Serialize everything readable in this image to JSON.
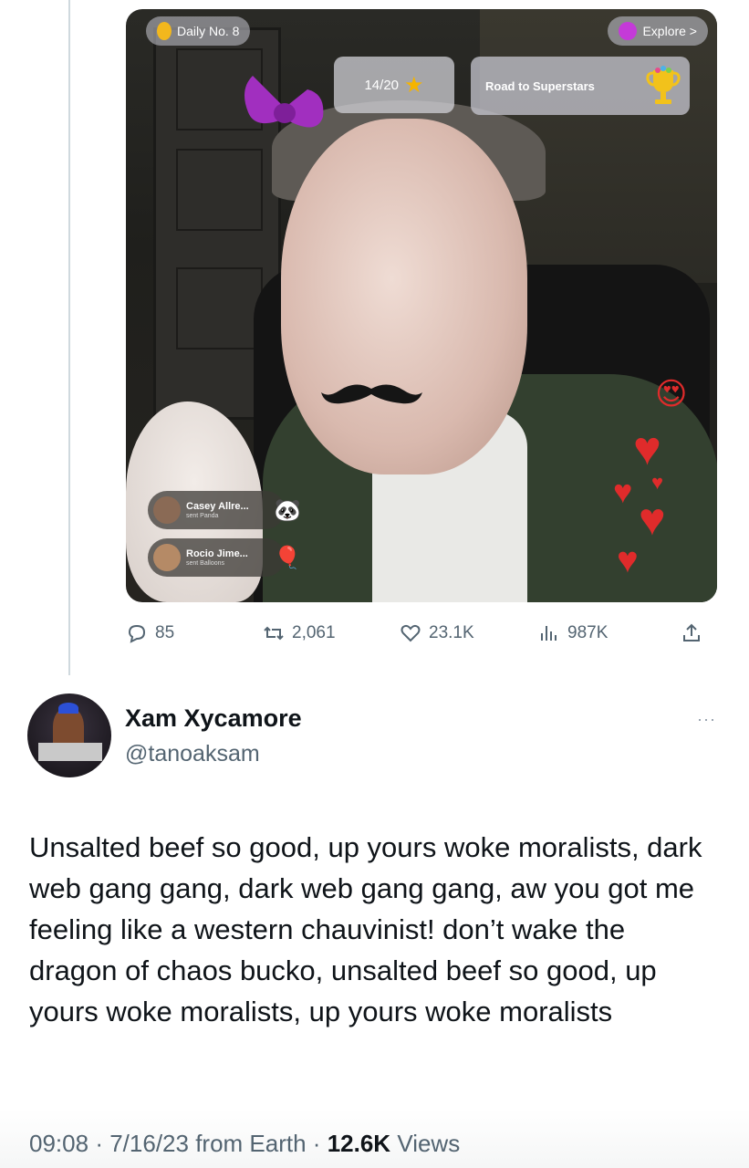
{
  "media": {
    "daily_label": "Daily No. 8",
    "explore_label": "Explore >",
    "progress_label": "14/20",
    "road_label": "Road to Superstars",
    "gifts": [
      {
        "name": "Casey Allre...",
        "sub": "sent Panda",
        "emoji": "🐼"
      },
      {
        "name": "Rocio Jime...",
        "sub": "sent Balloons",
        "emoji": "🎈"
      }
    ]
  },
  "actions": {
    "replies": "85",
    "reposts": "2,061",
    "likes": "23.1K",
    "views": "987K"
  },
  "author": {
    "display_name": "Xam Xycamore",
    "handle": "@tanoaksam",
    "more": "···"
  },
  "tweet": {
    "text": "Unsalted beef so good, up yours woke moralists, dark web gang gang, dark web gang gang, aw you got me feeling like a western chauvinist! don’t wake the dragon of chaos bucko, unsalted beef so good, up yours woke moralists, up yours woke moralists"
  },
  "meta": {
    "time": "09:08",
    "date": "7/16/23 from Earth",
    "views_count": "12.6K",
    "views_word": "Views",
    "sep": "·"
  },
  "colors": {
    "text": "#0f1419",
    "secondary": "#536471",
    "thread_line": "#cfd9de",
    "heart": "#e02b2b"
  }
}
